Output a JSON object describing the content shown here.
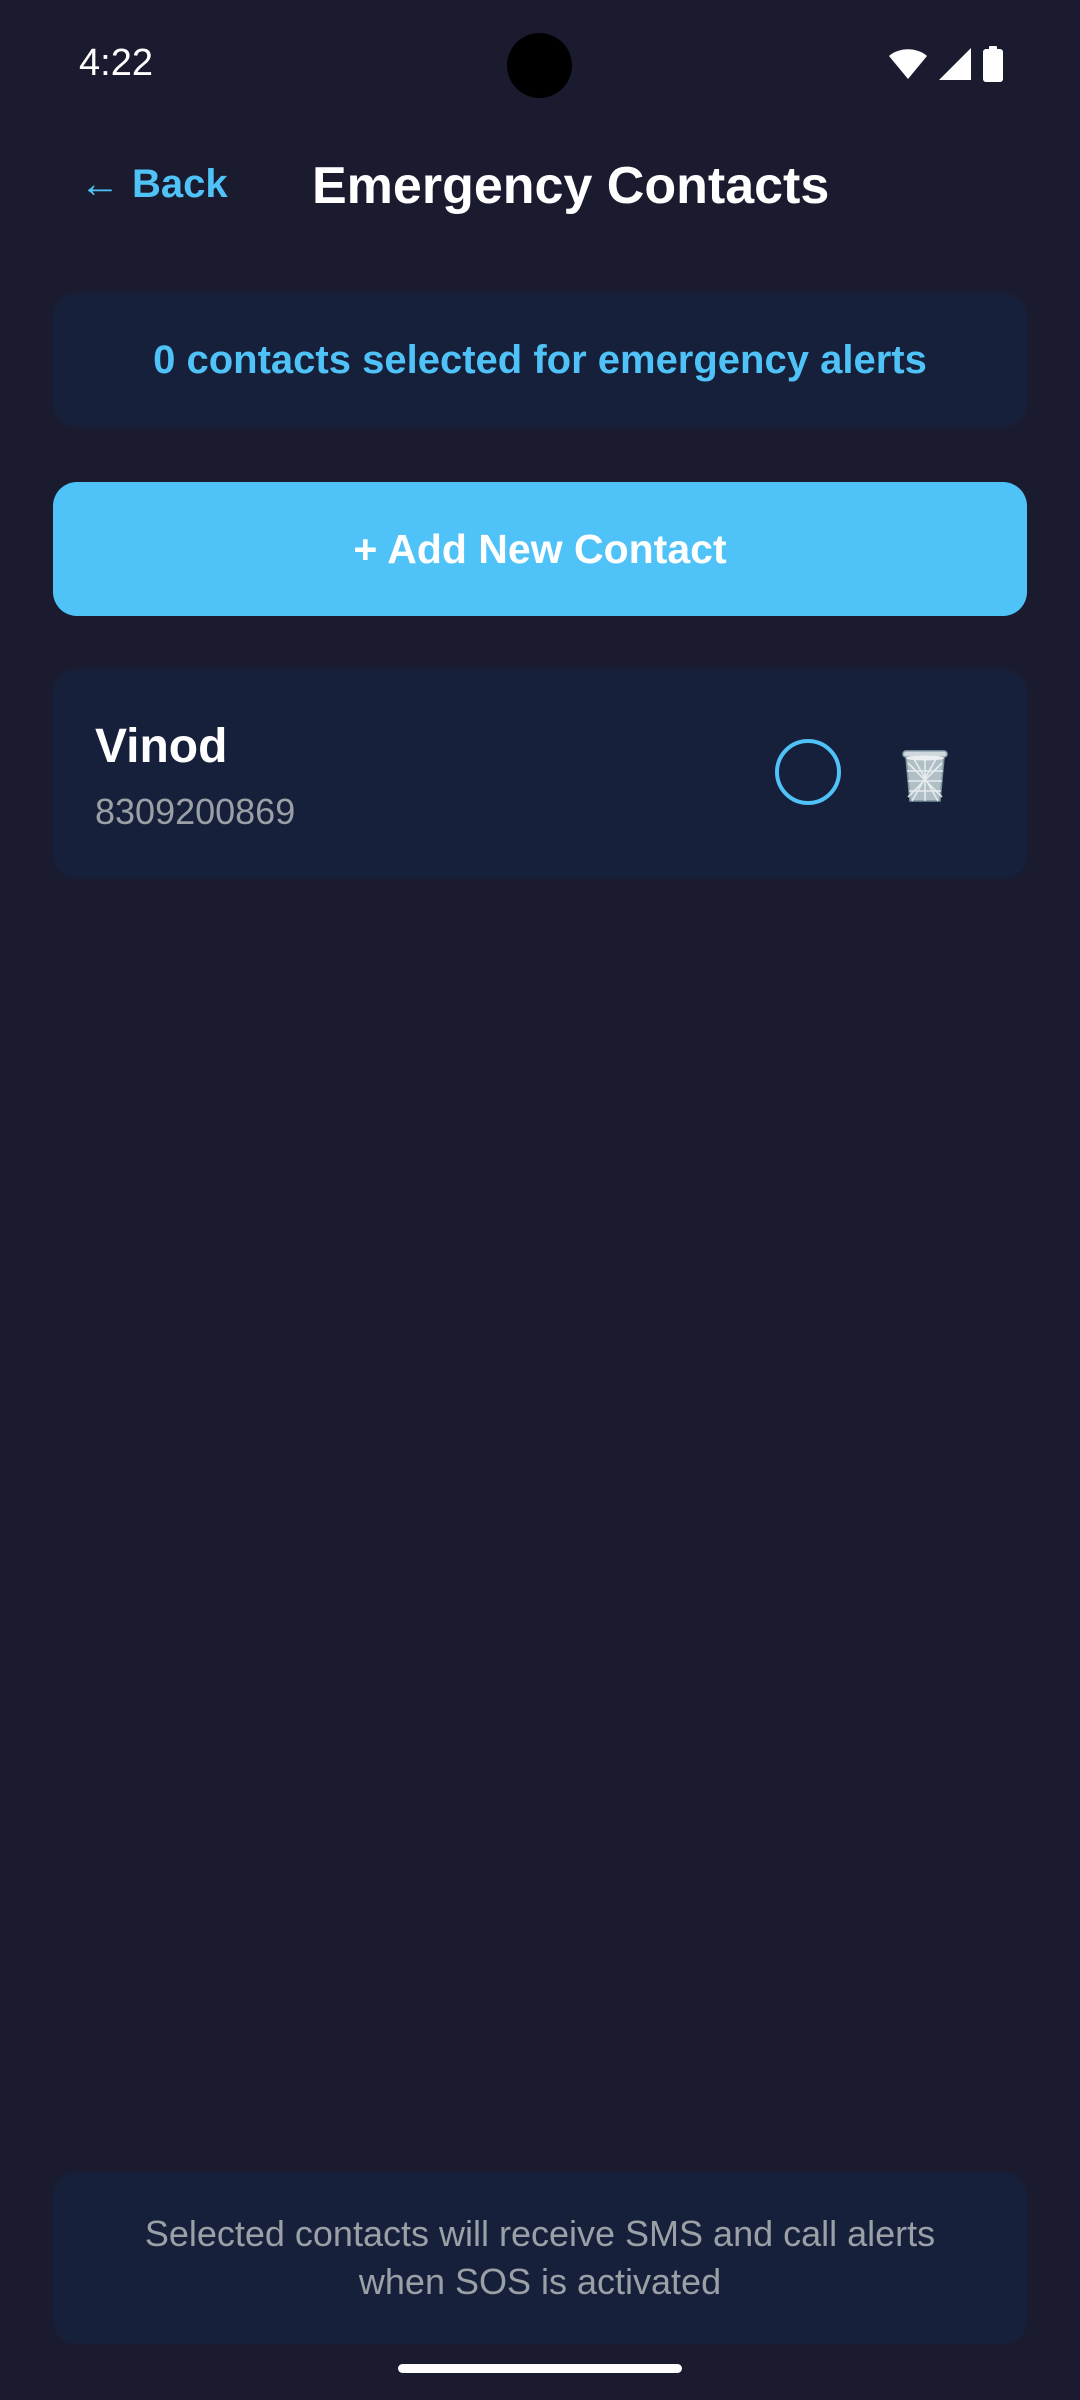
{
  "status_bar": {
    "time": "4:22",
    "icons": [
      "wifi-icon",
      "cell-signal-icon",
      "battery-icon"
    ]
  },
  "header": {
    "back_arrow": "←",
    "back_label": "Back",
    "title": "Emergency Contacts"
  },
  "banner": {
    "text": "0 contacts selected for emergency alerts"
  },
  "add_button": {
    "label": "+ Add New Contact"
  },
  "contacts": [
    {
      "name": "Vinod",
      "phone": "8309200869",
      "selected": false,
      "select_icon": "radio-circle-icon",
      "delete_icon": "trash-can-icon"
    }
  ],
  "footer": {
    "text": "Selected contacts will receive SMS and call alerts when SOS is activated"
  },
  "colors": {
    "background": "#1b1b2f",
    "card": "#16203b",
    "accent": "#4fc3f7",
    "secondary_text": "#9aa0a6"
  }
}
